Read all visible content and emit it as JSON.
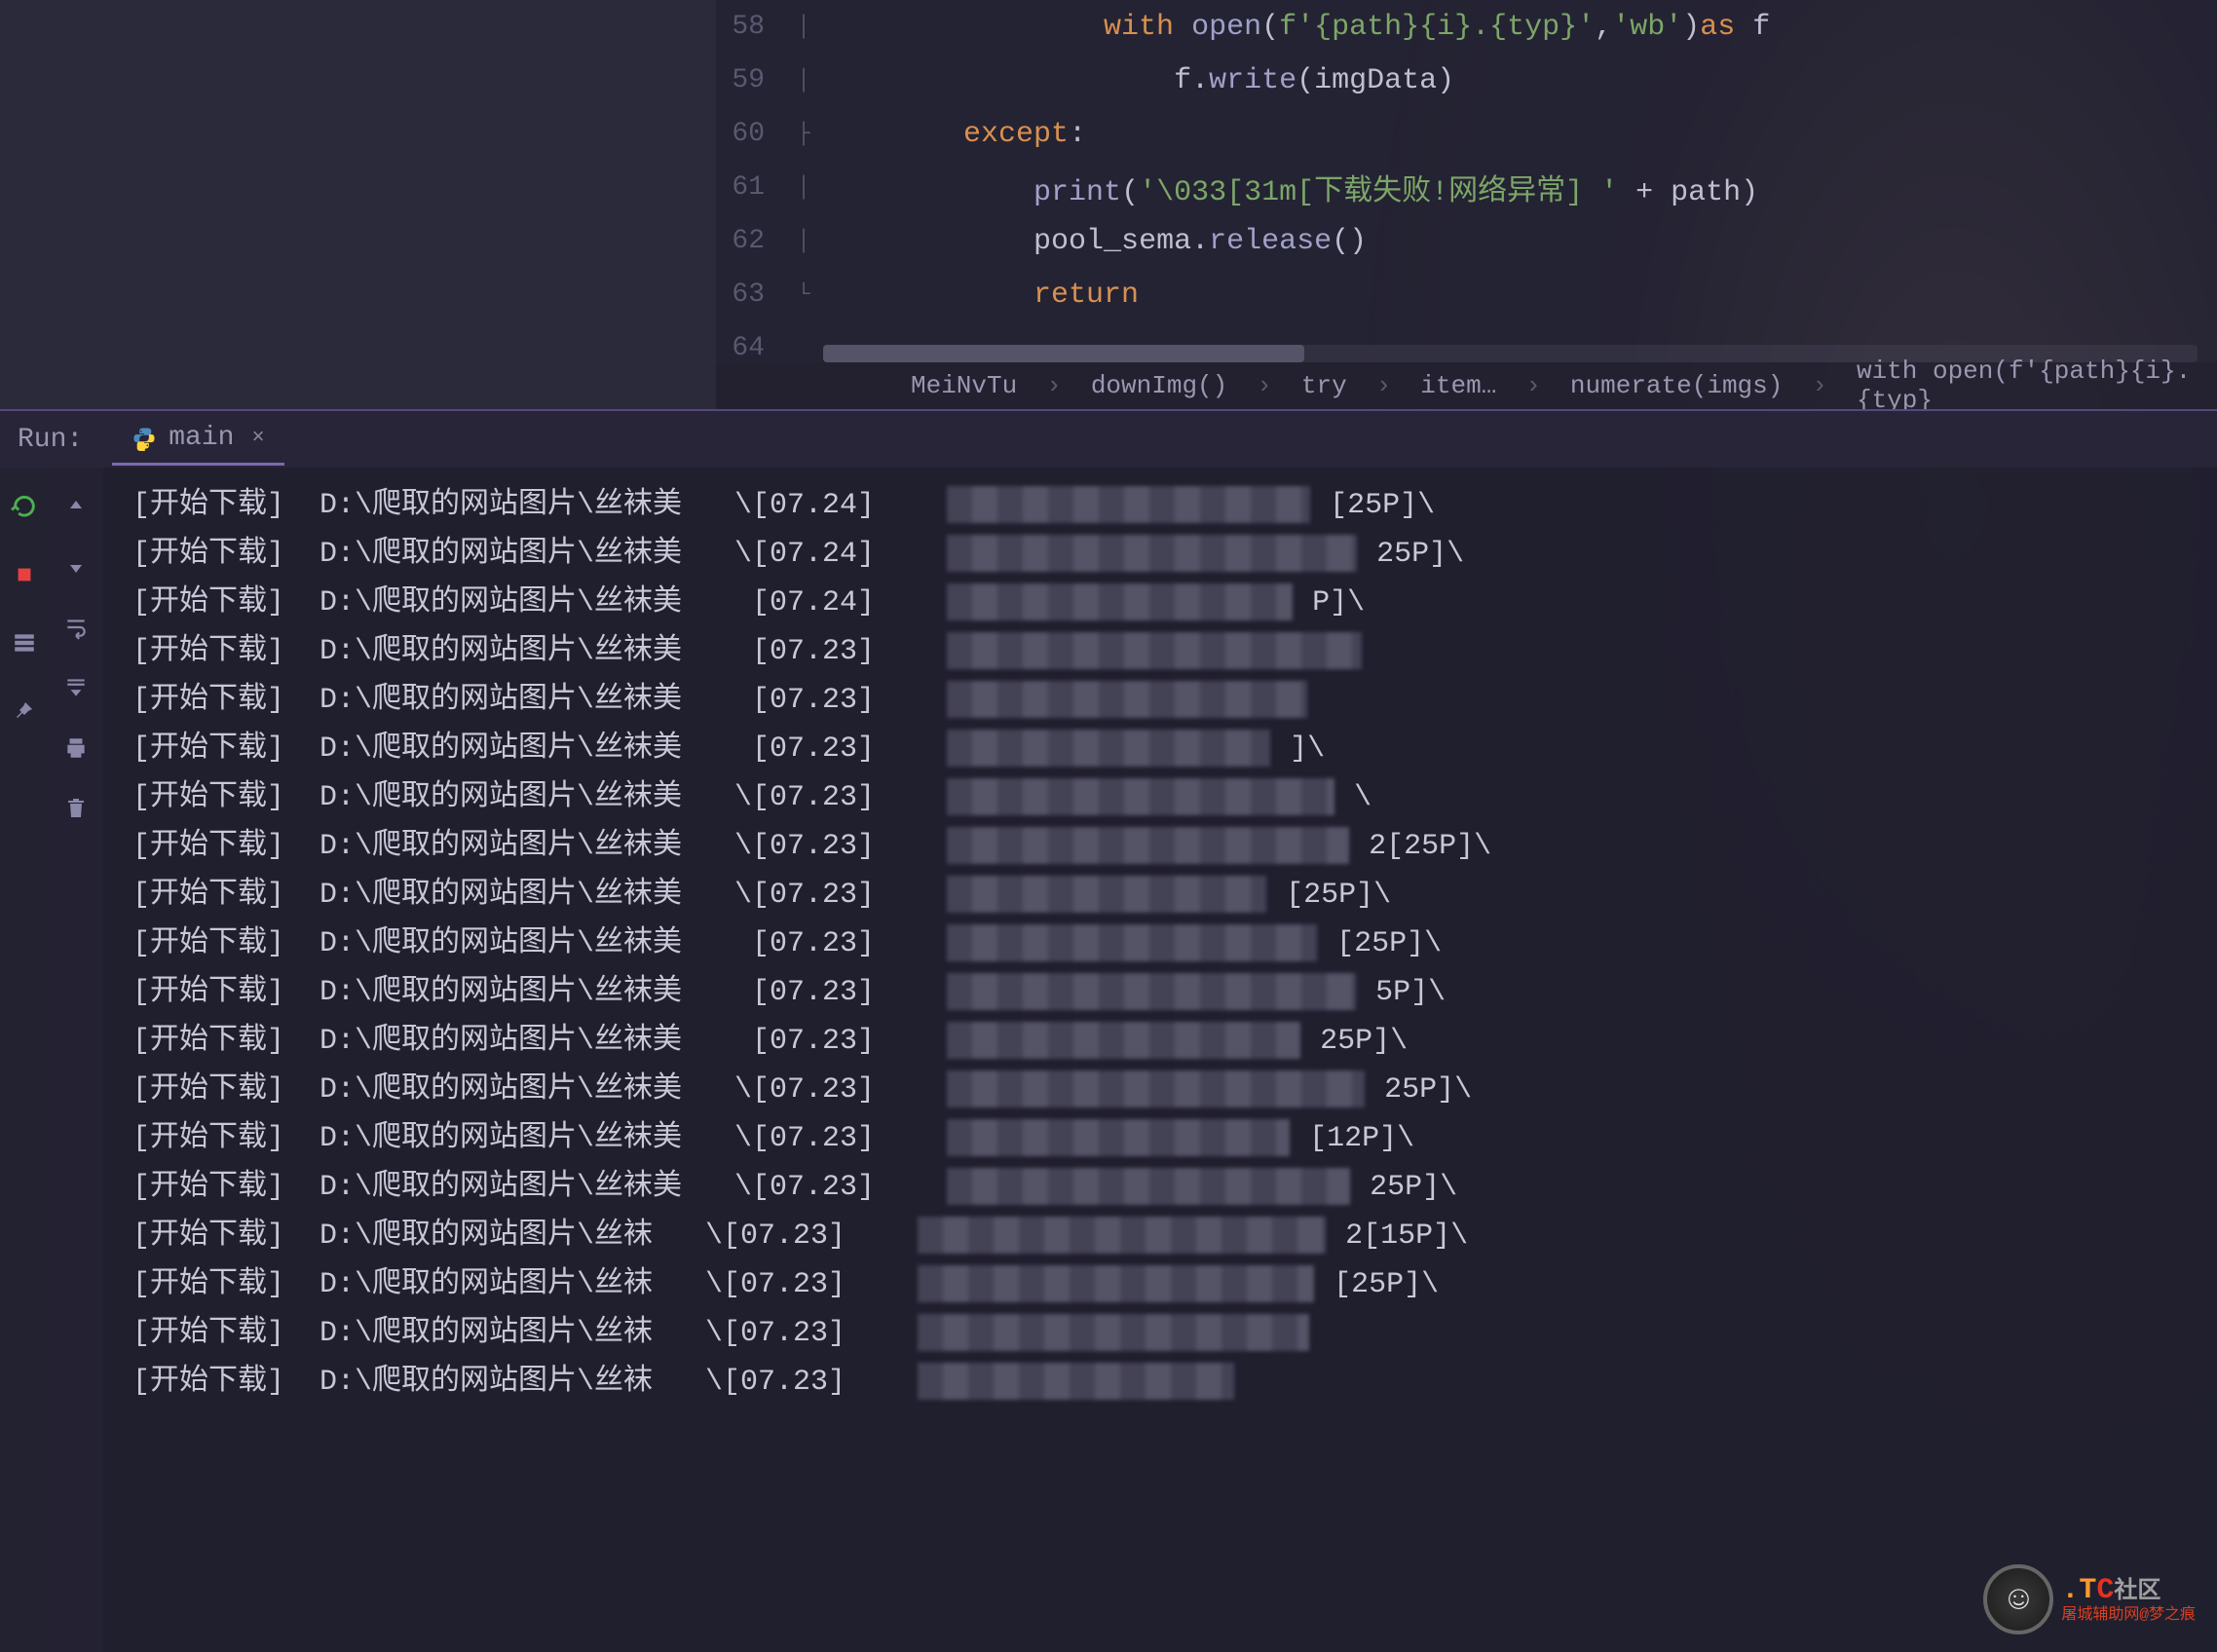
{
  "editor": {
    "lines": [
      {
        "num": "58",
        "fold": "│",
        "indent": "                ",
        "tokens": [
          {
            "cls": "kw",
            "t": "with"
          },
          {
            "cls": "",
            "t": " "
          },
          {
            "cls": "fn",
            "t": "open"
          },
          {
            "cls": "punc",
            "t": "("
          },
          {
            "cls": "str",
            "t": "f'{path}{i}.{typ}'"
          },
          {
            "cls": "punc",
            "t": ","
          },
          {
            "cls": "str",
            "t": "'wb'"
          },
          {
            "cls": "punc",
            "t": ")"
          },
          {
            "cls": "kw",
            "t": "as"
          },
          {
            "cls": "",
            "t": " f"
          }
        ]
      },
      {
        "num": "59",
        "fold": "│",
        "indent": "                    ",
        "tokens": [
          {
            "cls": "",
            "t": "f."
          },
          {
            "cls": "fn",
            "t": "write"
          },
          {
            "cls": "punc",
            "t": "("
          },
          {
            "cls": "",
            "t": "imgData"
          },
          {
            "cls": "punc",
            "t": ")"
          }
        ]
      },
      {
        "num": "60",
        "fold": "├",
        "indent": "        ",
        "tokens": [
          {
            "cls": "kw",
            "t": "except"
          },
          {
            "cls": "punc",
            "t": ":"
          }
        ]
      },
      {
        "num": "61",
        "fold": "│",
        "indent": "            ",
        "tokens": [
          {
            "cls": "fn",
            "t": "print"
          },
          {
            "cls": "punc",
            "t": "("
          },
          {
            "cls": "str",
            "t": "'\\033[31m[下载失败!网络异常] '"
          },
          {
            "cls": "",
            "t": " "
          },
          {
            "cls": "op",
            "t": "+"
          },
          {
            "cls": "",
            "t": " path"
          },
          {
            "cls": "punc",
            "t": ")"
          }
        ]
      },
      {
        "num": "62",
        "fold": "│",
        "indent": "            ",
        "tokens": [
          {
            "cls": "",
            "t": "pool_sema."
          },
          {
            "cls": "fn",
            "t": "release"
          },
          {
            "cls": "punc",
            "t": "()"
          }
        ]
      },
      {
        "num": "63",
        "fold": "└",
        "indent": "            ",
        "tokens": [
          {
            "cls": "kw",
            "t": "return"
          }
        ]
      },
      {
        "num": "64",
        "fold": "",
        "indent": "",
        "tokens": []
      }
    ]
  },
  "breadcrumb": [
    "MeiNvTu",
    "downImg()",
    "try",
    "item…",
    "numerate(imgs)",
    "with open(f'{path}{i}.{typ}"
  ],
  "run": {
    "label": "Run:",
    "tab_name": "main",
    "console_lines": [
      {
        "prefix": "[开始下载]  D:\\爬取的网站图片\\丝袜美",
        "mid": "\\[07.24]",
        "suffix": "[25P]\\"
      },
      {
        "prefix": "[开始下载]  D:\\爬取的网站图片\\丝袜美",
        "mid": "\\[07.24]",
        "suffix": "25P]\\"
      },
      {
        "prefix": "[开始下载]  D:\\爬取的网站图片\\丝袜美",
        "mid": " [07.24]",
        "suffix": "P]\\"
      },
      {
        "prefix": "[开始下载]  D:\\爬取的网站图片\\丝袜美",
        "mid": " [07.23]",
        "suffix": ""
      },
      {
        "prefix": "[开始下载]  D:\\爬取的网站图片\\丝袜美",
        "mid": " [07.23]",
        "suffix": ""
      },
      {
        "prefix": "[开始下载]  D:\\爬取的网站图片\\丝袜美",
        "mid": " [07.23]",
        "suffix": "]\\"
      },
      {
        "prefix": "[开始下载]  D:\\爬取的网站图片\\丝袜美",
        "mid": "\\[07.23]",
        "suffix": "\\"
      },
      {
        "prefix": "[开始下载]  D:\\爬取的网站图片\\丝袜美",
        "mid": "\\[07.23]",
        "suffix": "2[25P]\\"
      },
      {
        "prefix": "[开始下载]  D:\\爬取的网站图片\\丝袜美",
        "mid": "\\[07.23]",
        "suffix": "[25P]\\"
      },
      {
        "prefix": "[开始下载]  D:\\爬取的网站图片\\丝袜美",
        "mid": " [07.23]",
        "suffix": "[25P]\\"
      },
      {
        "prefix": "[开始下载]  D:\\爬取的网站图片\\丝袜美",
        "mid": " [07.23]",
        "suffix": "5P]\\"
      },
      {
        "prefix": "[开始下载]  D:\\爬取的网站图片\\丝袜美",
        "mid": " [07.23]",
        "suffix": "25P]\\"
      },
      {
        "prefix": "[开始下载]  D:\\爬取的网站图片\\丝袜美",
        "mid": "\\[07.23]",
        "suffix": "25P]\\"
      },
      {
        "prefix": "[开始下载]  D:\\爬取的网站图片\\丝袜美",
        "mid": "\\[07.23]",
        "suffix": "[12P]\\"
      },
      {
        "prefix": "[开始下载]  D:\\爬取的网站图片\\丝袜美",
        "mid": "\\[07.23]",
        "suffix": "25P]\\"
      },
      {
        "prefix": "[开始下载]  D:\\爬取的网站图片\\丝袜",
        "mid": "\\[07.23]",
        "suffix": "2[15P]\\"
      },
      {
        "prefix": "[开始下载]  D:\\爬取的网站图片\\丝袜",
        "mid": "\\[07.23]",
        "suffix": "[25P]\\"
      },
      {
        "prefix": "[开始下载]  D:\\爬取的网站图片\\丝袜",
        "mid": "\\[07.23]",
        "suffix": ""
      },
      {
        "prefix": "[开始下载]  D:\\爬取的网站图片\\丝袜",
        "mid": "\\[07.23]",
        "suffix": ""
      }
    ]
  },
  "watermark": {
    "t": ".T",
    "c": "C",
    "cn": "社区",
    "sub": "屠城辅助网@梦之痕"
  }
}
